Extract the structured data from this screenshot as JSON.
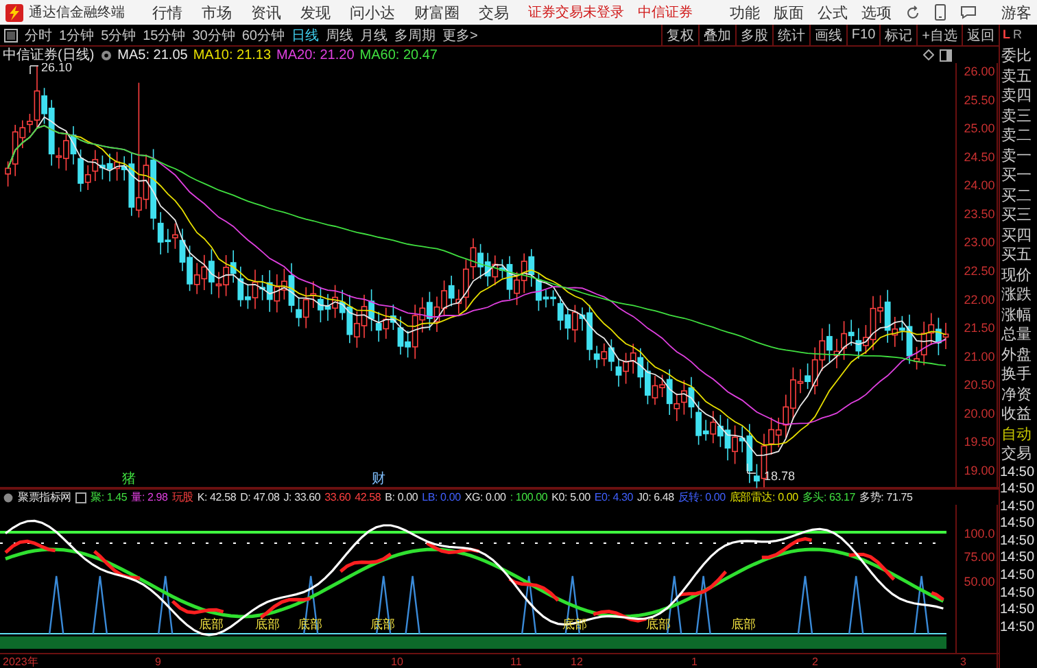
{
  "app": {
    "title": "通达信金融终端",
    "menu": [
      "行情",
      "市场",
      "资讯",
      "发现",
      "问小达",
      "财富圈",
      "交易"
    ],
    "login_status": "证券交易未登录",
    "broker": "中信证券",
    "tools": [
      "功能",
      "版面",
      "公式",
      "选项"
    ],
    "user": "游客"
  },
  "period_tabs": [
    {
      "label": "分时",
      "selected": false
    },
    {
      "label": "1分钟",
      "selected": false
    },
    {
      "label": "5分钟",
      "selected": false
    },
    {
      "label": "15分钟",
      "selected": false
    },
    {
      "label": "30分钟",
      "selected": false
    },
    {
      "label": "60分钟",
      "selected": false
    },
    {
      "label": "日线",
      "selected": true
    },
    {
      "label": "周线",
      "selected": false
    },
    {
      "label": "月线",
      "selected": false
    },
    {
      "label": "多周期",
      "selected": false
    },
    {
      "label": "更多>",
      "selected": false
    }
  ],
  "toolbar": [
    "复权",
    "叠加",
    "多股",
    "统计",
    "画线",
    "F10",
    "标记",
    "+自选",
    "返回"
  ],
  "panel_switch": [
    {
      "label": "L",
      "selected": true
    },
    {
      "label": "R",
      "selected": false
    }
  ],
  "chart": {
    "title": "中信证券(日线)",
    "mas": [
      {
        "label": "MA5: 21.05",
        "color": "#e8e8e8"
      },
      {
        "label": "MA10: 21.13",
        "color": "#e8e000"
      },
      {
        "label": "MA20: 21.20",
        "color": "#e040e0"
      },
      {
        "label": "MA60: 20.47",
        "color": "#40e040"
      }
    ],
    "high_label": "26.10",
    "low_label": "18.78",
    "price_ticks": [
      "26.00",
      "25.50",
      "25.00",
      "24.50",
      "24.00",
      "23.50",
      "23.00",
      "22.50",
      "22.00",
      "21.50",
      "21.00",
      "20.50",
      "20.00",
      "19.50",
      "19.00"
    ],
    "events": [
      "猪",
      "财"
    ]
  },
  "quote_panel": [
    {
      "label": "委比",
      "color": "#d0d0d0"
    },
    {
      "label": "卖五",
      "color": "#d0d0d0"
    },
    {
      "label": "卖四",
      "color": "#d0d0d0"
    },
    {
      "label": "卖三",
      "color": "#d0d0d0"
    },
    {
      "label": "卖二",
      "color": "#d0d0d0"
    },
    {
      "label": "卖一",
      "color": "#d0d0d0"
    },
    {
      "label": "买一",
      "color": "#d0d0d0"
    },
    {
      "label": "买二",
      "color": "#d0d0d0"
    },
    {
      "label": "买三",
      "color": "#d0d0d0"
    },
    {
      "label": "买四",
      "color": "#d0d0d0"
    },
    {
      "label": "买五",
      "color": "#d0d0d0"
    },
    {
      "label": "现价",
      "color": "#d0d0d0"
    },
    {
      "label": "涨跌",
      "color": "#d0d0d0"
    },
    {
      "label": "涨幅",
      "color": "#d0d0d0"
    },
    {
      "label": "总量",
      "color": "#d0d0d0"
    },
    {
      "label": "外盘",
      "color": "#d0d0d0"
    },
    {
      "label": "换手",
      "color": "#d0d0d0"
    },
    {
      "label": "净资",
      "color": "#d0d0d0"
    },
    {
      "label": "收益",
      "color": "#d0d0d0"
    },
    {
      "label": "自动",
      "color": "#c8c800"
    },
    {
      "label": "交易",
      "color": "#d0d0d0"
    }
  ],
  "trade_times": [
    "14:50",
    "14:50",
    "14:50",
    "14:50",
    "14:50",
    "14:50",
    "14:50",
    "14:50",
    "14:50",
    "14:50"
  ],
  "indicator": {
    "name": "聚票指标网",
    "values": [
      {
        "text": "聚: 1.45",
        "color": "#40e040"
      },
      {
        "text": "量: 2.98",
        "color": "#e040e0"
      },
      {
        "text": "玩股",
        "color": "#ff4040"
      },
      {
        "text": "K: 42.58",
        "color": "#e0e0e0"
      },
      {
        "text": "D: 47.08",
        "color": "#e0e0e0"
      },
      {
        "text": "J: 33.60",
        "color": "#e0e0e0"
      },
      {
        "text": "33.60",
        "color": "#ff4040"
      },
      {
        "text": "42.58",
        "color": "#ff4040"
      },
      {
        "text": "B: 0.00",
        "color": "#e0e0e0"
      },
      {
        "text": "LB: 0.00",
        "color": "#4060ff"
      },
      {
        "text": "XG: 0.00",
        "color": "#e0e0e0"
      },
      {
        "text": ": 100.00",
        "color": "#40e040"
      },
      {
        "text": "K0: 5.00",
        "color": "#e0e0e0"
      },
      {
        "text": "E0: 4.30",
        "color": "#4060ff"
      },
      {
        "text": "J0: 6.48",
        "color": "#e0e0e0"
      },
      {
        "text": "反转: 0.00",
        "color": "#4060ff"
      },
      {
        "text": "底部雷达: 0.00",
        "color": "#e0e000"
      },
      {
        "text": "多头: 63.17",
        "color": "#40e040"
      },
      {
        "text": "多势: 71.75",
        "color": "#e0e0e0"
      }
    ],
    "ticks": [
      "100.0",
      "75.00",
      "50.00"
    ],
    "signals": [
      "底部",
      "底部",
      "底部",
      "底部",
      "底部",
      "底部",
      "底部"
    ]
  },
  "x_axis": [
    "2023年",
    "9",
    "10",
    "11",
    "12",
    "1",
    "2",
    "3"
  ]
}
